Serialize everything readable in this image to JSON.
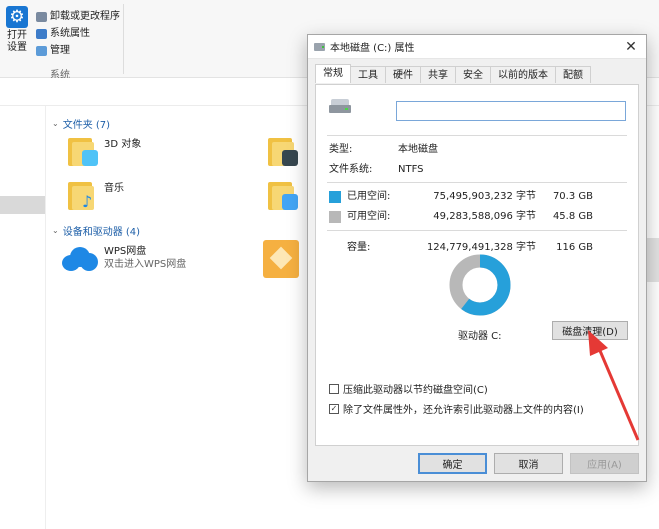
{
  "ribbon": {
    "open_settings": "打开\n设置",
    "items": [
      "卸载或更改程序",
      "系统属性",
      "管理"
    ],
    "group_label": "系统"
  },
  "explorer": {
    "folders_header": "文件夹 (7)",
    "folders": [
      {
        "name": "3D 对象"
      },
      {
        "name": "音乐"
      }
    ],
    "devices_header": "设备和驱动器 (4)",
    "wps": {
      "name": "WPS网盘",
      "subtitle": "双击进入WPS网盘"
    }
  },
  "dialog": {
    "title": "本地磁盘 (C:) 属性",
    "tabs": [
      "常规",
      "工具",
      "硬件",
      "共享",
      "安全",
      "以前的版本",
      "配额"
    ],
    "active_tab": "常规",
    "name_value": "",
    "type_label": "类型:",
    "type_value": "本地磁盘",
    "fs_label": "文件系统:",
    "fs_value": "NTFS",
    "used_label": "已用空间:",
    "used_bytes": "75,495,903,232 字节",
    "used_gb": "70.3 GB",
    "free_label": "可用空间:",
    "free_bytes": "49,283,588,096 字节",
    "free_gb": "45.8 GB",
    "capacity_label": "容量:",
    "capacity_bytes": "124,779,491,328 字节",
    "capacity_gb": "116 GB",
    "used_fraction": 0.605,
    "drive_label": "驱动器 C:",
    "cleanup_button": "磁盘清理(D)",
    "compress_label": "压缩此驱动器以节约磁盘空间(C)",
    "compress_checked": false,
    "index_label": "除了文件属性外，还允许索引此驱动器上文件的内容(I)",
    "index_checked": true,
    "ok_button": "确定",
    "cancel_button": "取消",
    "apply_button": "应用(A)"
  },
  "colors": {
    "used": "#26a0da",
    "free": "#b8b8b8",
    "annotation_arrow": "#e53935"
  }
}
